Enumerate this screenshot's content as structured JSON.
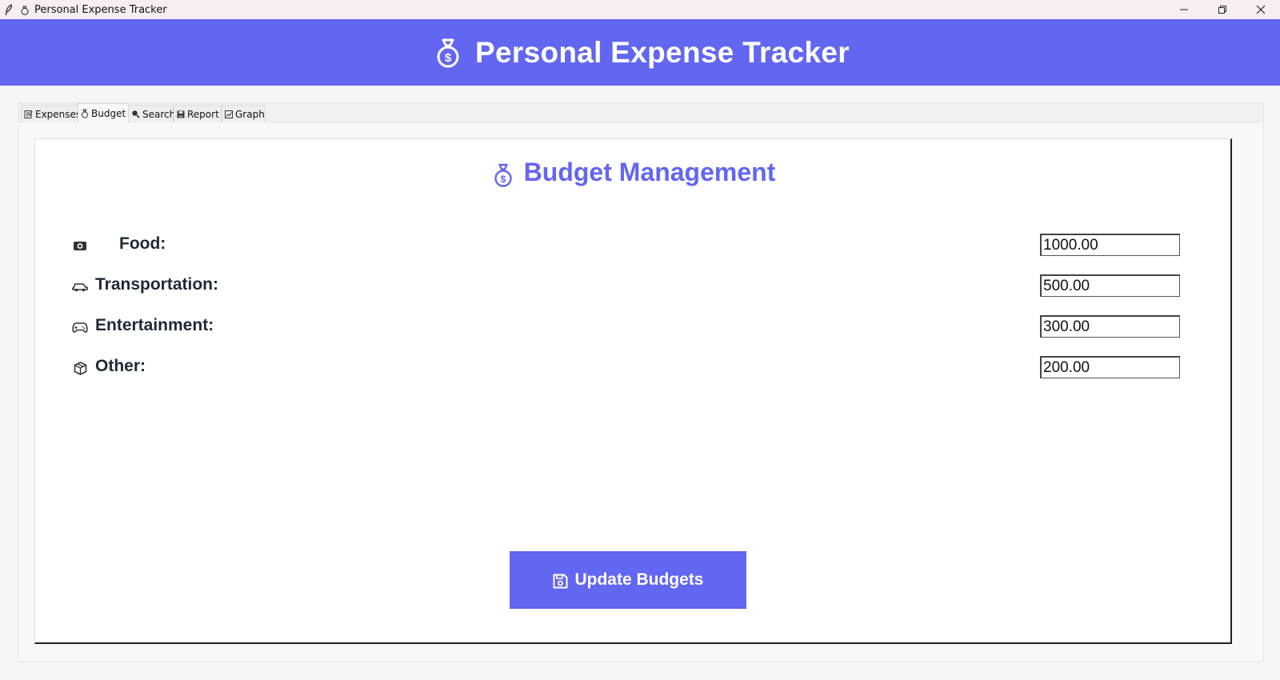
{
  "window": {
    "title": "Personal Expense Tracker"
  },
  "header": {
    "title": "Personal Expense Tracker",
    "icon": "money-bag-icon"
  },
  "tabs": [
    {
      "label": "Expenses",
      "icon": "memo-icon",
      "active": false
    },
    {
      "label": "Budget",
      "icon": "money-bag-icon",
      "active": true
    },
    {
      "label": "Search",
      "icon": "magnifier-icon",
      "active": false
    },
    {
      "label": "Report",
      "icon": "floppy-icon",
      "active": false
    },
    {
      "label": "Graph",
      "icon": "chart-icon",
      "active": false
    }
  ],
  "budget": {
    "title": "Budget Management",
    "rows": [
      {
        "icon": "food-icon",
        "label": "Food:",
        "value": "1000.00"
      },
      {
        "icon": "car-icon",
        "label": "Transportation:",
        "value": "500.00"
      },
      {
        "icon": "gamepad-icon",
        "label": "Entertainment:",
        "value": "300.00"
      },
      {
        "icon": "package-icon",
        "label": "Other:",
        "value": "200.00"
      }
    ],
    "update_button": {
      "label": "Update Budgets",
      "icon": "floppy-disk-icon"
    }
  },
  "colors": {
    "accent": "#6366f1",
    "text_dark": "#1f2937",
    "titlebar": "#f6eef3"
  }
}
